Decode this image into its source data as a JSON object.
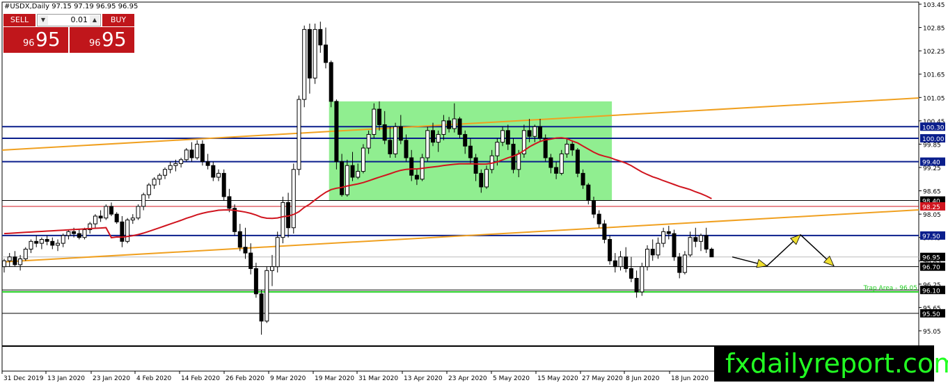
{
  "chart": {
    "symbol_label": "#USDX,Daily  97.15 97.19 96.95 96.95",
    "watermark": "fxdailyreport.com",
    "colors": {
      "bull_candle": "#ffffff",
      "bear_candle": "#000000",
      "blue_lines": "#0a1e8c",
      "orange_trend": "#f0a020",
      "red_ma": "#d0141e",
      "green_zone": "#90ee90",
      "trap_line": "#22cc22",
      "arrows": "#f0e030"
    },
    "y_axis_ticks": [
      "103.45",
      "102.85",
      "102.25",
      "101.65",
      "101.05",
      "100.45",
      "99.85",
      "99.25",
      "98.65",
      "98.05",
      "97.45",
      "96.85",
      "96.25",
      "95.65",
      "95.05"
    ],
    "x_axis_ticks": [
      "31 Dec 2019",
      "13 Jan 2020",
      "23 Jan 2020",
      "4 Feb 2020",
      "14 Feb 2020",
      "26 Feb 2020",
      "9 Mar 2020",
      "19 Mar 2020",
      "31 Mar 2020",
      "13 Apr 2020",
      "23 Apr 2020",
      "5 May 2020",
      "15 May 2020",
      "27 May 2020",
      "8 Jun 2020",
      "18 Jun 2020"
    ],
    "price_labels": [
      {
        "text": "100.30",
        "value": 100.3,
        "color": "#0a1e8c"
      },
      {
        "text": "100.00",
        "value": 100.0,
        "color": "#0a1e8c"
      },
      {
        "text": "99.40",
        "value": 99.4,
        "color": "#0a1e8c"
      },
      {
        "text": "98.40",
        "value": 98.4,
        "color": "#000000"
      },
      {
        "text": "98.25",
        "value": 98.25,
        "color": "#d0141e"
      },
      {
        "text": "97.50",
        "value": 97.5,
        "color": "#0a1e8c"
      },
      {
        "text": "96.95",
        "value": 96.95,
        "color": "#000000"
      },
      {
        "text": "96.70",
        "value": 96.7,
        "color": "#000000"
      },
      {
        "text": "96.10",
        "value": 96.1,
        "color": "#000000"
      },
      {
        "text": "95.50",
        "value": 95.5,
        "color": "#000000"
      }
    ],
    "trap_label": "Trap Area - 96.05",
    "trade_panel": {
      "sell_label": "SELL",
      "buy_label": "BUY",
      "lot_value": "0.01",
      "sell_price_small": "96",
      "sell_price_big": "95",
      "buy_price_small": "96",
      "buy_price_big": "95"
    }
  },
  "chart_data": {
    "type": "candlestick",
    "symbol": "#USDX",
    "timeframe": "Daily",
    "last_ohlc": {
      "open": 97.15,
      "high": 97.19,
      "low": 96.95,
      "close": 96.95
    },
    "ylim": [
      94.95,
      103.55
    ],
    "ohlc": [
      [
        96.7,
        96.9,
        96.55,
        96.85
      ],
      [
        96.85,
        97.05,
        96.7,
        96.95
      ],
      [
        96.95,
        97.1,
        96.7,
        96.75
      ],
      [
        96.75,
        97.0,
        96.6,
        96.9
      ],
      [
        96.9,
        97.2,
        96.85,
        97.15
      ],
      [
        97.15,
        97.4,
        97.05,
        97.35
      ],
      [
        97.35,
        97.5,
        97.2,
        97.3
      ],
      [
        97.3,
        97.45,
        97.15,
        97.4
      ],
      [
        97.4,
        97.5,
        97.25,
        97.35
      ],
      [
        97.35,
        97.45,
        97.15,
        97.25
      ],
      [
        97.25,
        97.4,
        97.1,
        97.3
      ],
      [
        97.3,
        97.55,
        97.2,
        97.5
      ],
      [
        97.5,
        97.65,
        97.4,
        97.6
      ],
      [
        97.6,
        97.7,
        97.45,
        97.55
      ],
      [
        97.55,
        97.65,
        97.4,
        97.45
      ],
      [
        97.45,
        97.7,
        97.4,
        97.65
      ],
      [
        97.65,
        97.85,
        97.55,
        97.8
      ],
      [
        97.8,
        98.05,
        97.7,
        98.0
      ],
      [
        98.0,
        98.15,
        97.85,
        97.95
      ],
      [
        97.95,
        98.3,
        97.9,
        98.25
      ],
      [
        98.25,
        98.35,
        98.0,
        98.05
      ],
      [
        98.05,
        98.1,
        97.8,
        97.85
      ],
      [
        97.85,
        98.0,
        97.2,
        97.35
      ],
      [
        97.35,
        97.95,
        97.3,
        97.9
      ],
      [
        97.9,
        98.05,
        97.8,
        97.95
      ],
      [
        97.95,
        98.3,
        97.9,
        98.25
      ],
      [
        98.25,
        98.6,
        98.15,
        98.55
      ],
      [
        98.55,
        98.85,
        98.45,
        98.8
      ],
      [
        98.8,
        99.0,
        98.7,
        98.95
      ],
      [
        98.95,
        99.1,
        98.8,
        99.05
      ],
      [
        99.05,
        99.25,
        98.95,
        99.2
      ],
      [
        99.2,
        99.4,
        99.1,
        99.3
      ],
      [
        99.3,
        99.45,
        99.15,
        99.35
      ],
      [
        99.35,
        99.5,
        99.25,
        99.45
      ],
      [
        99.45,
        99.75,
        99.4,
        99.7
      ],
      [
        99.7,
        99.9,
        99.4,
        99.5
      ],
      [
        99.5,
        99.95,
        99.45,
        99.85
      ],
      [
        99.85,
        99.95,
        99.3,
        99.4
      ],
      [
        99.4,
        99.6,
        99.2,
        99.3
      ],
      [
        99.3,
        99.4,
        98.9,
        99.0
      ],
      [
        99.0,
        99.2,
        98.9,
        99.1
      ],
      [
        99.1,
        99.2,
        98.4,
        98.5
      ],
      [
        98.5,
        98.7,
        98.1,
        98.2
      ],
      [
        98.2,
        98.3,
        97.5,
        97.6
      ],
      [
        97.6,
        97.8,
        97.1,
        97.2
      ],
      [
        97.2,
        97.7,
        96.9,
        97.05
      ],
      [
        97.05,
        97.3,
        96.5,
        96.65
      ],
      [
        96.65,
        96.8,
        95.9,
        96.0
      ],
      [
        96.0,
        96.1,
        94.95,
        95.3
      ],
      [
        95.3,
        96.7,
        95.25,
        96.6
      ],
      [
        96.6,
        97.0,
        96.2,
        96.7
      ],
      [
        96.7,
        97.6,
        96.55,
        97.45
      ],
      [
        97.45,
        98.5,
        97.3,
        98.35
      ],
      [
        98.35,
        98.6,
        97.45,
        97.7
      ],
      [
        97.7,
        99.35,
        97.55,
        99.2
      ],
      [
        99.2,
        101.1,
        99.05,
        101.0
      ],
      [
        101.0,
        102.9,
        100.8,
        102.8
      ],
      [
        102.8,
        102.95,
        101.15,
        101.55
      ],
      [
        101.55,
        102.95,
        101.4,
        102.8
      ],
      [
        102.8,
        103.0,
        102.2,
        102.4
      ],
      [
        102.4,
        102.85,
        101.8,
        101.95
      ],
      [
        101.95,
        102.0,
        100.8,
        100.95
      ],
      [
        100.95,
        101.0,
        99.2,
        99.4
      ],
      [
        99.4,
        99.6,
        98.5,
        98.55
      ],
      [
        98.55,
        99.45,
        98.5,
        99.3
      ],
      [
        99.3,
        99.65,
        98.9,
        99.0
      ],
      [
        99.0,
        99.35,
        98.95,
        99.15
      ],
      [
        99.15,
        99.85,
        99.1,
        99.75
      ],
      [
        99.75,
        100.2,
        99.6,
        100.1
      ],
      [
        100.1,
        100.9,
        100.0,
        100.75
      ],
      [
        100.75,
        100.95,
        100.2,
        100.35
      ],
      [
        100.35,
        100.7,
        99.85,
        99.95
      ],
      [
        99.95,
        100.3,
        99.5,
        99.6
      ],
      [
        99.6,
        100.4,
        99.5,
        100.3
      ],
      [
        100.3,
        100.6,
        99.85,
        99.95
      ],
      [
        99.95,
        100.1,
        99.4,
        99.5
      ],
      [
        99.5,
        99.7,
        98.9,
        99.05
      ],
      [
        99.05,
        99.2,
        98.8,
        98.95
      ],
      [
        98.95,
        99.6,
        98.9,
        99.5
      ],
      [
        99.5,
        100.3,
        99.4,
        100.2
      ],
      [
        100.2,
        100.4,
        99.8,
        99.9
      ],
      [
        99.9,
        100.2,
        99.65,
        100.1
      ],
      [
        100.1,
        100.6,
        99.95,
        100.45
      ],
      [
        100.45,
        100.55,
        100.15,
        100.25
      ],
      [
        100.25,
        100.9,
        100.15,
        100.5
      ],
      [
        100.5,
        100.55,
        100.0,
        100.1
      ],
      [
        100.1,
        100.2,
        99.6,
        99.8
      ],
      [
        99.8,
        100.0,
        99.35,
        99.5
      ],
      [
        99.5,
        99.6,
        98.9,
        99.1
      ],
      [
        99.1,
        99.2,
        98.6,
        98.75
      ],
      [
        98.75,
        99.3,
        98.7,
        99.2
      ],
      [
        99.2,
        99.7,
        99.1,
        99.55
      ],
      [
        99.55,
        100.0,
        99.3,
        99.9
      ],
      [
        99.9,
        100.3,
        99.8,
        100.2
      ],
      [
        100.2,
        100.35,
        99.7,
        99.85
      ],
      [
        99.85,
        100.0,
        99.1,
        99.2
      ],
      [
        99.2,
        99.7,
        99.0,
        99.6
      ],
      [
        99.6,
        100.35,
        99.5,
        100.2
      ],
      [
        100.2,
        100.5,
        99.9,
        100.05
      ],
      [
        100.05,
        100.35,
        99.9,
        100.3
      ],
      [
        100.3,
        100.5,
        99.9,
        100.0
      ],
      [
        100.0,
        100.1,
        99.4,
        99.5
      ],
      [
        99.5,
        99.6,
        99.1,
        99.25
      ],
      [
        99.25,
        99.4,
        98.95,
        99.1
      ],
      [
        99.1,
        99.7,
        99.05,
        99.6
      ],
      [
        99.6,
        100.0,
        99.5,
        99.85
      ],
      [
        99.85,
        99.95,
        99.55,
        99.7
      ],
      [
        99.7,
        99.75,
        99.0,
        99.1
      ],
      [
        99.1,
        99.2,
        98.7,
        98.8
      ],
      [
        98.8,
        98.85,
        98.3,
        98.4
      ],
      [
        98.4,
        98.5,
        97.95,
        98.05
      ],
      [
        98.05,
        98.15,
        97.7,
        97.8
      ],
      [
        97.8,
        97.9,
        97.3,
        97.4
      ],
      [
        97.4,
        97.5,
        96.75,
        96.85
      ],
      [
        96.85,
        97.05,
        96.55,
        96.7
      ],
      [
        96.7,
        97.1,
        96.6,
        96.95
      ],
      [
        96.95,
        97.2,
        96.55,
        96.65
      ],
      [
        96.65,
        96.95,
        96.3,
        96.4
      ],
      [
        96.4,
        96.6,
        95.9,
        96.05
      ],
      [
        96.05,
        96.8,
        95.95,
        96.7
      ],
      [
        96.7,
        97.25,
        96.6,
        97.15
      ],
      [
        97.15,
        97.4,
        96.85,
        97.0
      ],
      [
        97.0,
        97.45,
        96.9,
        97.3
      ],
      [
        97.3,
        97.7,
        97.2,
        97.6
      ],
      [
        97.6,
        97.75,
        97.4,
        97.55
      ],
      [
        97.55,
        97.65,
        96.85,
        96.95
      ],
      [
        96.95,
        97.05,
        96.4,
        96.55
      ],
      [
        96.55,
        97.1,
        96.5,
        97.0
      ],
      [
        97.0,
        97.6,
        96.95,
        97.45
      ],
      [
        97.45,
        97.7,
        97.2,
        97.35
      ],
      [
        97.35,
        97.55,
        97.1,
        97.5
      ],
      [
        97.5,
        97.7,
        97.05,
        97.15
      ],
      [
        97.15,
        97.19,
        96.95,
        96.95
      ]
    ],
    "horizontal_levels": [
      100.3,
      100.0,
      99.4,
      98.4,
      98.25,
      97.5,
      96.95,
      96.7,
      96.1,
      95.5
    ],
    "trap_area": 96.05,
    "range_zone": {
      "from_index": 61,
      "to_index": 113,
      "top": 100.95,
      "bottom": 98.4
    },
    "forecast_path": [
      96.95,
      96.72,
      97.52,
      96.72
    ]
  }
}
